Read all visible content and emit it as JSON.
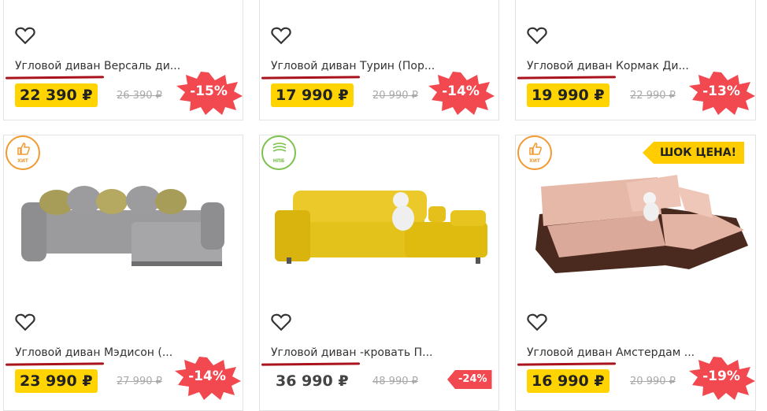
{
  "products": [
    {
      "title_prefix": "Угловой диван",
      "title_rest": " Версаль ди...",
      "price": "22 390 ₽",
      "old_price": "26 390 ₽",
      "discount": "-15%"
    },
    {
      "title_prefix": "Угловой диван",
      "title_rest": " Турин (Пор...",
      "price": "17 990 ₽",
      "old_price": "20 990 ₽",
      "discount": "-14%"
    },
    {
      "title_prefix": "Угловой диван",
      "title_rest": " Кормак Ди...",
      "price": "19 990 ₽",
      "old_price": "22 990 ₽",
      "discount": "-13%"
    },
    {
      "badge": "ХИТ",
      "title_prefix": "Угловой диван",
      "title_rest": " Мэдисон (...",
      "price": "23 990 ₽",
      "old_price": "27 990 ₽",
      "discount": "-14%"
    },
    {
      "badge": "НПБ",
      "title_prefix": "Угловой диван",
      "title_rest": " -кровать П...",
      "price": "36 990 ₽",
      "old_price": "48 990 ₽",
      "discount": "-24%"
    },
    {
      "badge": "ХИТ",
      "promo": "ШОК ЦЕНА!",
      "title_prefix": "Угловой диван",
      "title_rest": " Амстердам ...",
      "price": "16 990 ₽",
      "old_price": "20 990 ₽",
      "discount": "-19%"
    }
  ],
  "colors": {
    "price_bg": "#ffd400",
    "discount_bg": "#f2484f",
    "underline": "#a8131c",
    "hit_badge": "#f29a31",
    "npb_badge": "#7cc24d",
    "promo_bg": "#ffcc00"
  }
}
